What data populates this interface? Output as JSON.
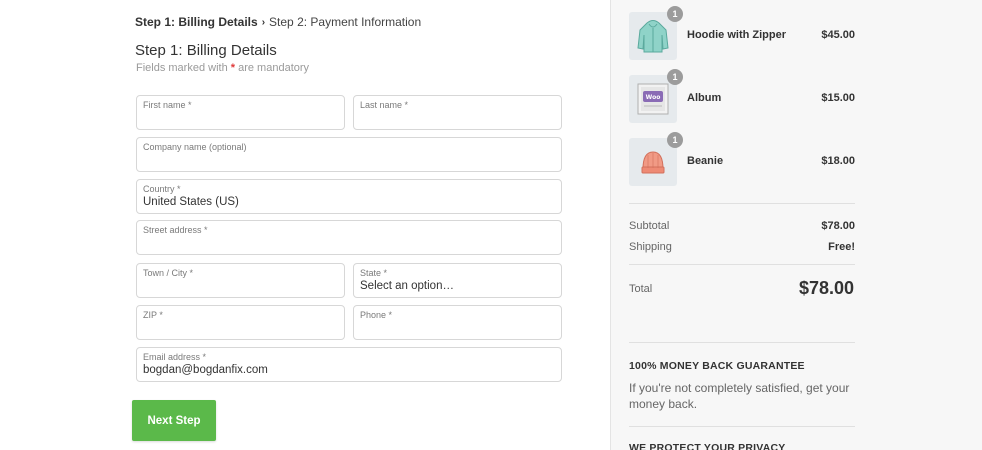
{
  "breadcrumb": {
    "step1": "Step 1: Billing Details",
    "separator": "›",
    "step2": "Step 2: Payment Information"
  },
  "form": {
    "title": "Step 1: Billing Details",
    "mandatory_prefix": "Fields marked with ",
    "mandatory_star": "*",
    "mandatory_suffix": " are mandatory",
    "fields": {
      "first_name": {
        "label": "First name *",
        "value": ""
      },
      "last_name": {
        "label": "Last name *",
        "value": ""
      },
      "company": {
        "label": "Company name (optional)",
        "value": ""
      },
      "country": {
        "label": "Country *",
        "value": "United States (US)"
      },
      "street": {
        "label": "Street address *",
        "value": ""
      },
      "city": {
        "label": "Town / City *",
        "value": ""
      },
      "state": {
        "label": "State *",
        "value": "Select an option…"
      },
      "zip": {
        "label": "ZIP *",
        "value": ""
      },
      "phone": {
        "label": "Phone *",
        "value": ""
      },
      "email": {
        "label": "Email address *",
        "value": "bogdan@bogdanfix.com"
      }
    },
    "next_button": "Next Step"
  },
  "cart": {
    "items": [
      {
        "name": "Hoodie with Zipper",
        "price": "$45.00",
        "qty": "1",
        "icon": "hoodie-icon"
      },
      {
        "name": "Album",
        "price": "$15.00",
        "qty": "1",
        "icon": "album-icon"
      },
      {
        "name": "Beanie",
        "price": "$18.00",
        "qty": "1",
        "icon": "beanie-icon"
      }
    ],
    "subtotal_label": "Subtotal",
    "subtotal_value": "$78.00",
    "shipping_label": "Shipping",
    "shipping_value": "Free!",
    "total_label": "Total",
    "total_value": "$78.00"
  },
  "guarantee": {
    "title": "100% MONEY BACK GUARANTEE",
    "text": "If you're not completely satisfied, get your money back."
  },
  "privacy": {
    "title": "WE PROTECT YOUR PRIVACY"
  },
  "colors": {
    "accent_green": "#5bb94a",
    "required_red": "#e03a3a",
    "sidebar_bg": "#f7f7f7"
  }
}
